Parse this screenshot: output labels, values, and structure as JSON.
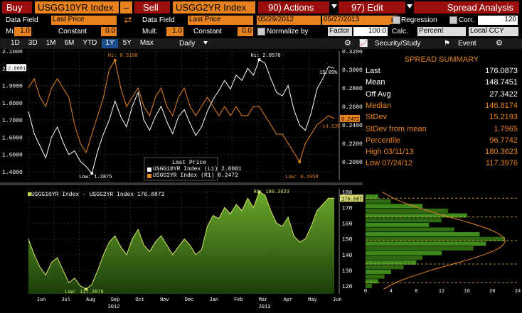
{
  "toolbar": {
    "buy_label": "Buy",
    "ticker1": "USGG10YR Index",
    "minus_label": "–",
    "sell_label": "Sell",
    "ticker2": "USGG2YR Index",
    "actions_label": "90) Actions",
    "edit_label": "97) Edit",
    "title": "Spread Analysis"
  },
  "row2": {
    "data_field_label": "Data Field",
    "data_field1": "Last Price",
    "data_field_label2": "Data Field",
    "data_field2": "Last Price",
    "date_from": "05/29/2012",
    "date_to": "05/27/2013",
    "regression_label": "Regression",
    "corr_label": "Corr.",
    "corr_value": "120"
  },
  "row3": {
    "mult_label": "Mult.",
    "mult1": "1.0",
    "constant_label": "Constant",
    "constant1": "0.0",
    "mult_label2": "Mult.",
    "mult2": "1.0",
    "constant_label2": "Constant",
    "constant2": "0.0",
    "normalize_label": "Normalize by",
    "factor_label": "Factor",
    "factor_value": "100.0",
    "calc_label": "Calc.",
    "calc_value": "Percent",
    "ccy_value": "Local CCY"
  },
  "tabs": {
    "periods": [
      "1D",
      "3D",
      "1M",
      "6M",
      "YTD",
      "1Y",
      "5Y",
      "Max"
    ],
    "selected": "1Y",
    "frequency": "Daily",
    "security_study": "Security/Study",
    "event": "Event"
  },
  "summary": {
    "title": "SPREAD SUMMARY",
    "rows": [
      {
        "label": "Last",
        "value": "176.0873",
        "color": "#ffffff"
      },
      {
        "label": "Mean",
        "value": "148.7451",
        "color": "#ffffff"
      },
      {
        "label": "Off Avg",
        "value": "27.3422",
        "color": "#ffffff"
      },
      {
        "label": "Median",
        "value": "146.8174",
        "color": "#e8821e"
      },
      {
        "label": "StDev",
        "value": "15.2193",
        "color": "#e8821e"
      },
      {
        "label": "StDev from mean",
        "value": "1.7965",
        "color": "#e8821e"
      },
      {
        "label": "Percentile",
        "value": "96.7742",
        "color": "#e8821e"
      },
      {
        "label": "High 03/11/13",
        "value": "180.3623",
        "color": "#e8821e"
      },
      {
        "label": "Low 07/24/12",
        "value": "117.3976",
        "color": "#e8821e"
      }
    ]
  },
  "chart_data": [
    {
      "type": "line",
      "title": "",
      "legend_title": "Last Price",
      "legend_position": "bottom-center",
      "series": [
        {
          "name": "USGG10YR Index (L1) 2.0081",
          "axis": "left",
          "color": "#ffffff",
          "values": [
            1.75,
            1.62,
            1.55,
            1.48,
            1.6,
            1.66,
            1.57,
            1.5,
            1.52,
            1.46,
            1.43,
            1.39,
            1.52,
            1.62,
            1.7,
            1.81,
            1.72,
            1.66,
            1.78,
            1.86,
            1.7,
            1.64,
            1.72,
            1.78,
            1.69,
            1.62,
            1.72,
            1.76,
            1.68,
            1.61,
            1.66,
            1.75,
            1.82,
            1.87,
            1.93,
            1.88,
            1.96,
            1.93,
            2.0,
            1.96,
            2.05,
            2.03,
            1.94,
            1.86,
            1.84,
            1.9,
            1.76,
            1.67,
            1.64,
            1.74,
            1.88,
            1.94,
            2.01,
            2.0
          ]
        },
        {
          "name": "USGG2YR Index (R1) 0.2472",
          "axis": "right",
          "color": "#e8821e",
          "values": [
            0.28,
            0.29,
            0.27,
            0.26,
            0.28,
            0.29,
            0.28,
            0.27,
            0.24,
            0.22,
            0.21,
            0.23,
            0.25,
            0.27,
            0.3,
            0.31,
            0.28,
            0.26,
            0.27,
            0.28,
            0.26,
            0.25,
            0.27,
            0.28,
            0.26,
            0.25,
            0.27,
            0.28,
            0.26,
            0.25,
            0.26,
            0.27,
            0.26,
            0.25,
            0.26,
            0.25,
            0.26,
            0.25,
            0.25,
            0.26,
            0.26,
            0.25,
            0.24,
            0.23,
            0.23,
            0.22,
            0.21,
            0.2,
            0.22,
            0.23,
            0.24,
            0.245,
            0.25,
            0.247
          ]
        }
      ],
      "ylim_left": [
        1.35,
        2.1
      ],
      "ylim_right": [
        0.18,
        0.32
      ],
      "yticks_left": [
        "2.1000",
        "2.0000",
        "1.9000",
        "1.8000",
        "1.7000",
        "1.6000",
        "1.5000",
        "1.4000"
      ],
      "yticks_right": [
        "0.3200",
        "0.3000",
        "0.2800",
        "0.2600",
        "0.2400",
        "0.2200",
        "0.2000"
      ],
      "annotations": [
        "Hi: 0.3108",
        "Hi: 2.0576",
        "Low: 1.3875",
        "Low: 0.1958",
        "15.09%",
        "-14.53%",
        "2.0081",
        "0.2472"
      ]
    },
    {
      "type": "area",
      "title": "USGG10YR Index - USGG2YR Index 176.0873",
      "x_labels": [
        "Jun",
        "Jul",
        "Aug",
        "Sep",
        "Oct",
        "Nov",
        "Dec",
        "Jan",
        "Feb",
        "Mar",
        "Apr",
        "May",
        "Jun"
      ],
      "year_labels": [
        "2012",
        "2013"
      ],
      "ylim": [
        115,
        182
      ],
      "yticks": [
        "180",
        "170",
        "160",
        "150",
        "140",
        "130",
        "120"
      ],
      "values": [
        150,
        140,
        132,
        127,
        135,
        138,
        130,
        122,
        125,
        120,
        118,
        121,
        130,
        140,
        148,
        152,
        145,
        140,
        150,
        156,
        146,
        142,
        148,
        152,
        146,
        140,
        145,
        150,
        146,
        140,
        143,
        158,
        165,
        163,
        170,
        166,
        172,
        168,
        176,
        170,
        180,
        178,
        168,
        160,
        158,
        164,
        152,
        148,
        150,
        158,
        168,
        172,
        176,
        176
      ],
      "annotations": [
        "Hi: 180.3623",
        "Low: 117.3976",
        "176.0873"
      ]
    },
    {
      "type": "bar",
      "orientation": "horizontal",
      "title": "",
      "xlabel": "",
      "ylabel": "",
      "x_ticks": [
        "0",
        "4",
        "8",
        "12",
        "16",
        "20",
        "24"
      ],
      "xlim": [
        0,
        24
      ],
      "bins": [
        177,
        174,
        171,
        168,
        165,
        162,
        159,
        156,
        153,
        150,
        147,
        144,
        141,
        138,
        135,
        132,
        129,
        126,
        123,
        120
      ],
      "counts": [
        2,
        4,
        9,
        13,
        16,
        12,
        10,
        14,
        18,
        22,
        19,
        17,
        12,
        9,
        8,
        6,
        4,
        3,
        2,
        1
      ]
    }
  ]
}
